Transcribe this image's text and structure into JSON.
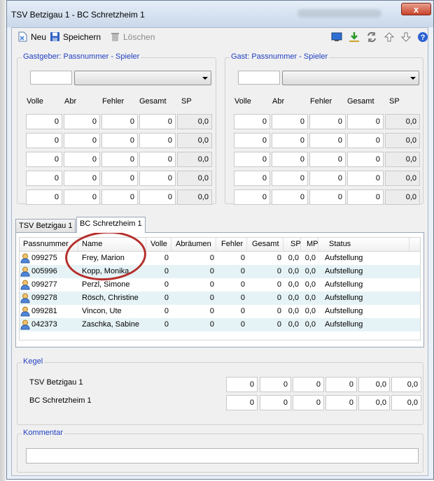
{
  "window": {
    "title": "TSV Betzigau 1 - BC Schretzheim 1",
    "close_label": "x"
  },
  "toolbar": {
    "new_label": "Neu",
    "save_label": "Speichern",
    "delete_label": "Löschen"
  },
  "host": {
    "group_label": "Gastgeber: Passnummer - Spieler",
    "passnr": "",
    "player": ""
  },
  "guest": {
    "group_label": "Gast: Passnummer - Spieler",
    "passnr": "",
    "player": ""
  },
  "score_headers": [
    "Volle",
    "Abr",
    "Fehler",
    "Gesamt",
    "SP"
  ],
  "host_scores": [
    [
      "0",
      "0",
      "0",
      "0",
      "0,0"
    ],
    [
      "0",
      "0",
      "0",
      "0",
      "0,0"
    ],
    [
      "0",
      "0",
      "0",
      "0",
      "0,0"
    ],
    [
      "0",
      "0",
      "0",
      "0",
      "0,0"
    ],
    [
      "0",
      "0",
      "0",
      "0",
      "0,0"
    ]
  ],
  "guest_scores": [
    [
      "0",
      "0",
      "0",
      "0",
      "0,0"
    ],
    [
      "0",
      "0",
      "0",
      "0",
      "0,0"
    ],
    [
      "0",
      "0",
      "0",
      "0",
      "0,0"
    ],
    [
      "0",
      "0",
      "0",
      "0",
      "0,0"
    ],
    [
      "0",
      "0",
      "0",
      "0",
      "0,0"
    ]
  ],
  "tabs": [
    {
      "label": "TSV Betzigau 1"
    },
    {
      "label": "BC Schretzheim 1"
    }
  ],
  "grid": {
    "headers": [
      "Passnummer",
      "Name",
      "Volle",
      "Abräumen",
      "Fehler",
      "Gesamt",
      "SP",
      "MP",
      "Status"
    ],
    "rows": [
      {
        "passnr": "099275",
        "name": "Frey, Marion",
        "volle": "0",
        "abr": "0",
        "fehler": "0",
        "gesamt": "0",
        "sp": "0,0",
        "mp": "0,0",
        "status": "Aufstellung"
      },
      {
        "passnr": "005996",
        "name": "Kopp, Monika",
        "volle": "0",
        "abr": "0",
        "fehler": "0",
        "gesamt": "0",
        "sp": "0,0",
        "mp": "0,0",
        "status": "Aufstellung"
      },
      {
        "passnr": "099277",
        "name": "Perzl, Simone",
        "volle": "0",
        "abr": "0",
        "fehler": "0",
        "gesamt": "0",
        "sp": "0,0",
        "mp": "0,0",
        "status": "Aufstellung"
      },
      {
        "passnr": "099278",
        "name": "Rösch, Christine",
        "volle": "0",
        "abr": "0",
        "fehler": "0",
        "gesamt": "0",
        "sp": "0,0",
        "mp": "0,0",
        "status": "Aufstellung"
      },
      {
        "passnr": "099281",
        "name": "Vincon, Ute",
        "volle": "0",
        "abr": "0",
        "fehler": "0",
        "gesamt": "0",
        "sp": "0,0",
        "mp": "0,0",
        "status": "Aufstellung"
      },
      {
        "passnr": "042373",
        "name": "Zaschka, Sabine",
        "volle": "0",
        "abr": "0",
        "fehler": "0",
        "gesamt": "0",
        "sp": "0,0",
        "mp": "0,0",
        "status": "Aufstellung"
      }
    ]
  },
  "kegel": {
    "group_label": "Kegel",
    "teams": [
      {
        "name": "TSV Betzigau 1",
        "values": [
          "0",
          "0",
          "0",
          "0",
          "0,0",
          "0,0"
        ]
      },
      {
        "name": "BC Schretzheim 1",
        "values": [
          "0",
          "0",
          "0",
          "0",
          "0,0",
          "0,0"
        ]
      }
    ]
  },
  "comment": {
    "group_label": "Kommentar",
    "value": ""
  },
  "colors": {
    "group_label": "#1f3fbf",
    "highlight_ellipse": "#b5302c",
    "row_alt": "#e6f3f6"
  }
}
